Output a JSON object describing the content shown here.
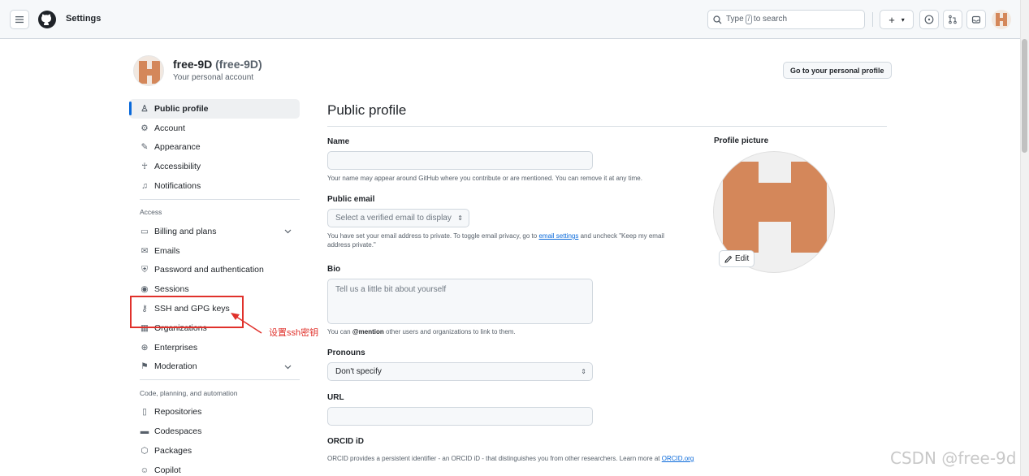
{
  "header": {
    "title": "Settings",
    "search_prefix": "Type",
    "search_key": "/",
    "search_suffix": "to search",
    "plus_label": "+",
    "plus_caret": "▾"
  },
  "account": {
    "name": "free-9D",
    "login": "(free-9D)",
    "subtitle": "Your personal account",
    "go_profile": "Go to your personal profile"
  },
  "sidebar": {
    "items_top": [
      {
        "label": "Public profile",
        "icon": "person-icon",
        "glyph": "♙"
      },
      {
        "label": "Account",
        "icon": "gear-icon",
        "glyph": "⚙"
      },
      {
        "label": "Appearance",
        "icon": "paintbrush-icon",
        "glyph": "✎"
      },
      {
        "label": "Accessibility",
        "icon": "accessibility-icon",
        "glyph": "☥"
      },
      {
        "label": "Notifications",
        "icon": "bell-icon",
        "glyph": "♫"
      }
    ],
    "access_heading": "Access",
    "items_access": [
      {
        "label": "Billing and plans",
        "icon": "credit-card-icon",
        "glyph": "▭"
      },
      {
        "label": "Emails",
        "icon": "mail-icon",
        "glyph": "✉"
      },
      {
        "label": "Password and authentication",
        "icon": "shield-lock-icon",
        "glyph": "⛨"
      },
      {
        "label": "Sessions",
        "icon": "broadcast-icon",
        "glyph": "◉"
      },
      {
        "label": "SSH and GPG keys",
        "icon": "key-icon",
        "glyph": "⚷"
      },
      {
        "label": "Organizations",
        "icon": "organization-icon",
        "glyph": "▦"
      },
      {
        "label": "Enterprises",
        "icon": "globe-icon",
        "glyph": "⊕"
      },
      {
        "label": "Moderation",
        "icon": "report-icon",
        "glyph": "⚑"
      }
    ],
    "code_heading": "Code, planning, and automation",
    "items_code": [
      {
        "label": "Repositories",
        "icon": "repo-icon",
        "glyph": "▯"
      },
      {
        "label": "Codespaces",
        "icon": "codespaces-icon",
        "glyph": "▬"
      },
      {
        "label": "Packages",
        "icon": "package-icon",
        "glyph": "⬡"
      },
      {
        "label": "Copilot",
        "icon": "copilot-icon",
        "glyph": "☺"
      }
    ]
  },
  "annotation": {
    "text": "设置ssh密钥",
    "color": "#e0312b"
  },
  "main": {
    "title": "Public profile",
    "name_label": "Name",
    "name_value": "",
    "name_note": "Your name may appear around GitHub where you contribute or are mentioned. You can remove it at any time.",
    "email_label": "Public email",
    "email_select": "Select a verified email to display",
    "email_note_1": "You have set your email address to private. To toggle email privacy, go to",
    "email_note_link": "email settings",
    "email_note_2": "and uncheck \"Keep my email address private.\"",
    "bio_label": "Bio",
    "bio_placeholder": "Tell us a little bit about yourself",
    "bio_note_1": "You can",
    "bio_note_mention": "@mention",
    "bio_note_2": "other users and organizations to link to them.",
    "pronouns_label": "Pronouns",
    "pronouns_value": "Don't specify",
    "url_label": "URL",
    "url_value": "",
    "orcid_label": "ORCID iD",
    "orcid_note": "ORCID provides a persistent identifier - an ORCID iD - that distinguishes you from other researchers. Learn more at",
    "orcid_link": "ORCID.org",
    "profile_picture_label": "Profile picture",
    "edit_label": "Edit"
  },
  "colors": {
    "accent": "#0969da",
    "avatar": "#d4875a"
  },
  "watermark": "CSDN @free-9d"
}
